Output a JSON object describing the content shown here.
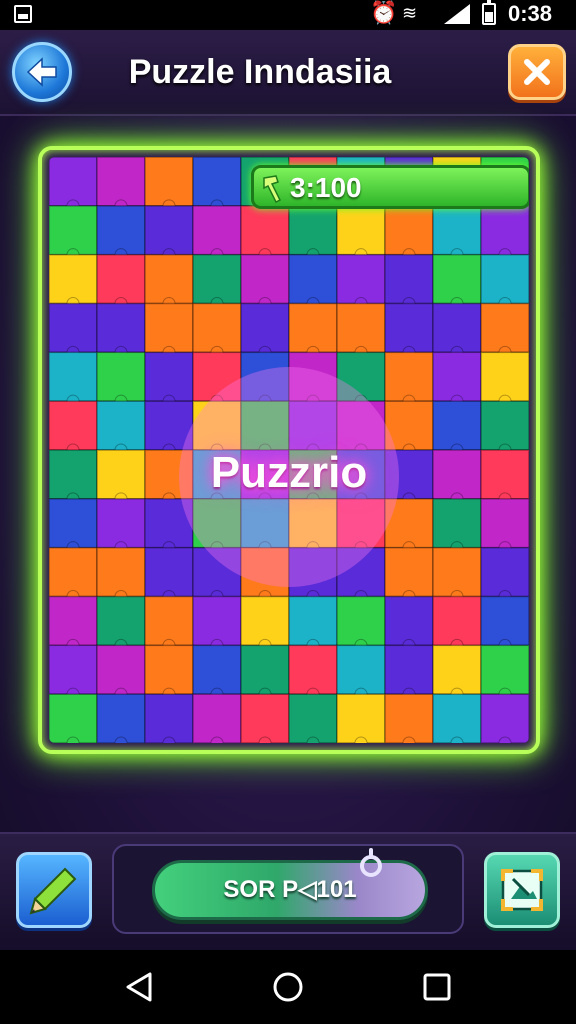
{
  "status_bar": {
    "time": "0:38",
    "icons": [
      "gallery-icon",
      "alarm-icon",
      "wifi-icon",
      "signal-icon",
      "battery-icon"
    ]
  },
  "header": {
    "title": "Puzzle Inndasiia",
    "back_icon": "arrow-left-icon",
    "close_icon": "close-x-icon"
  },
  "board": {
    "score": "3:100",
    "center_label": "Puzzrio",
    "columns": 10,
    "rows": 12,
    "piece_colors": [
      "#8a2be2",
      "#2e4fd8",
      "#1cb3c8",
      "#2fd14a",
      "#ff7a1a",
      "#ff3a5a",
      "#ffd21a",
      "#c126c9",
      "#14a36e",
      "#5a2bd8"
    ],
    "frame_color": "#b8ff5a"
  },
  "toolbar": {
    "pencil_icon": "pencil-icon",
    "action_label": "SOR P◁101",
    "picture_icon": "picture-frame-icon"
  },
  "navbar": {
    "icons": [
      "back-triangle-icon",
      "home-circle-icon",
      "recents-square-icon"
    ]
  }
}
